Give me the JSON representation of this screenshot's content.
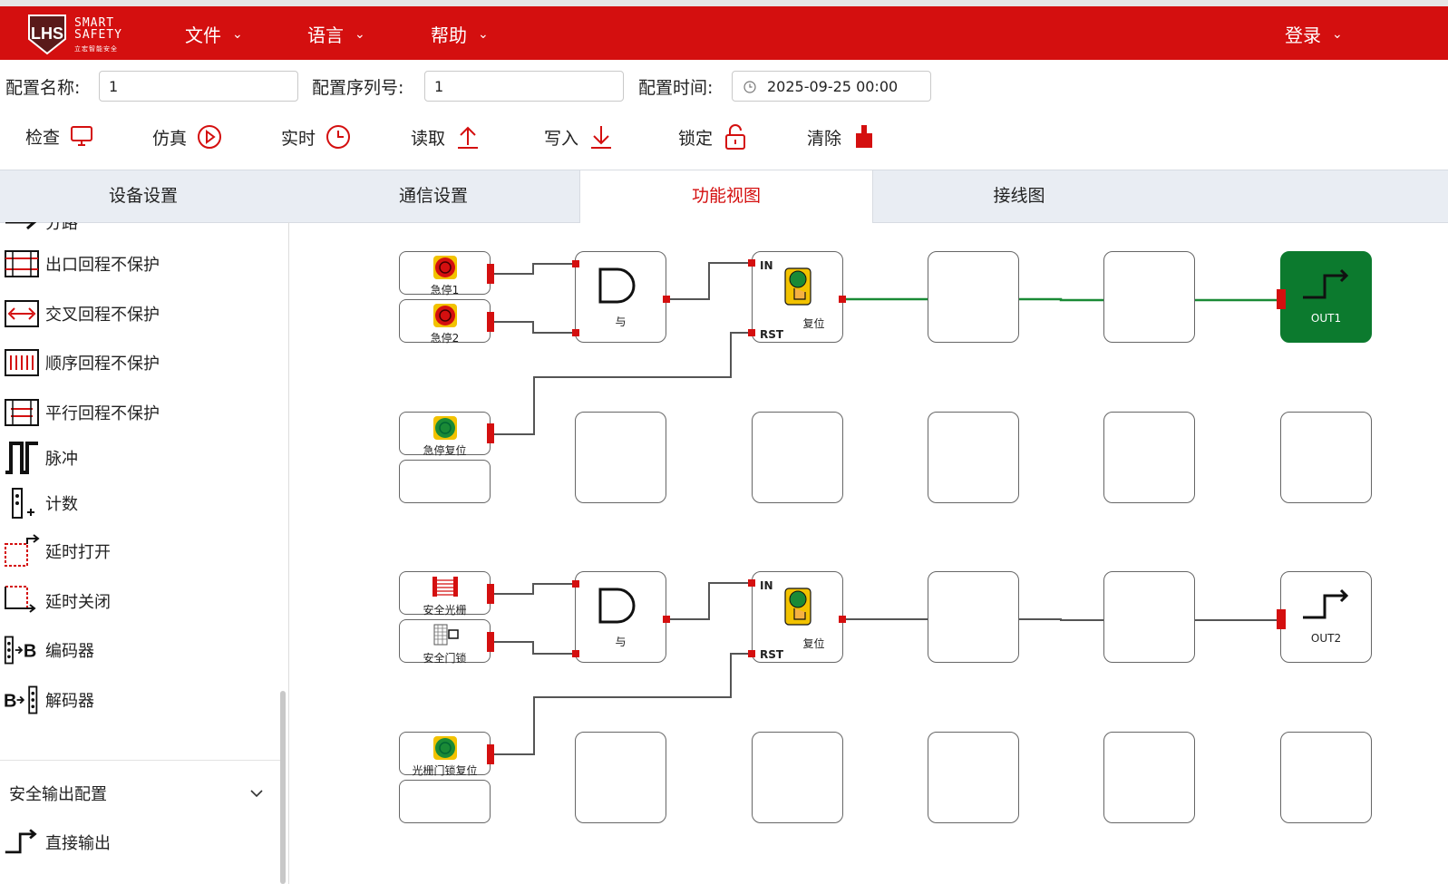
{
  "header": {
    "logo_text_1": "SMART",
    "logo_text_2": "SAFETY",
    "logo_sub": "立宏智能安全",
    "logo_mark": "LHS",
    "menus": [
      {
        "label": "文件"
      },
      {
        "label": "语言"
      },
      {
        "label": "帮助"
      }
    ],
    "login_label": "登录",
    "bg_color": "#d40f0f"
  },
  "config": {
    "name_label": "配置名称:",
    "name_value": "1",
    "serial_label": "配置序列号:",
    "serial_value": "1",
    "time_label": "配置时间:",
    "time_value": "2025-09-25 00:00"
  },
  "toolbar": {
    "check": "检查",
    "simulate": "仿真",
    "realtime": "实时",
    "read": "读取",
    "write": "写入",
    "lock": "锁定",
    "clear": "清除"
  },
  "tabs": [
    {
      "label": "设备设置"
    },
    {
      "label": "通信设置"
    },
    {
      "label": "功能视图",
      "active": true
    },
    {
      "label": "接线图"
    }
  ],
  "sidebar": {
    "partial_item": "分路",
    "items": [
      {
        "label": "出口回程不保护",
        "icon": "exit-return-icon"
      },
      {
        "label": "交叉回程不保护",
        "icon": "cross-return-icon"
      },
      {
        "label": "顺序回程不保护",
        "icon": "sequence-return-icon"
      },
      {
        "label": "平行回程不保护",
        "icon": "parallel-return-icon"
      },
      {
        "label": "脉冲",
        "icon": "pulse-icon"
      },
      {
        "label": "计数",
        "icon": "counter-icon"
      },
      {
        "label": "延时打开",
        "icon": "delay-on-icon"
      },
      {
        "label": "延时关闭",
        "icon": "delay-off-icon"
      },
      {
        "label": "编码器",
        "icon": "encoder-icon"
      },
      {
        "label": "解码器",
        "icon": "decoder-icon"
      }
    ],
    "section_title": "安全输出配置",
    "output_item": "直接输出"
  },
  "canvas": {
    "inputs": {
      "estop1": "急停1",
      "estop2": "急停2",
      "estop_reset": "急停复位",
      "light_curtain": "安全光栅",
      "door_lock": "安全门锁",
      "curtain_lock_reset": "光栅门锁复位"
    },
    "and_label": "与",
    "reset_label": "复位",
    "pin_in": "IN",
    "pin_rst": "RST",
    "out1": "OUT1",
    "out2": "OUT2",
    "out1_active_color": "#0c7a2e",
    "wire_active_color": "#1a8a36",
    "wire_color": "#555555",
    "port_color": "#d40f0f"
  }
}
